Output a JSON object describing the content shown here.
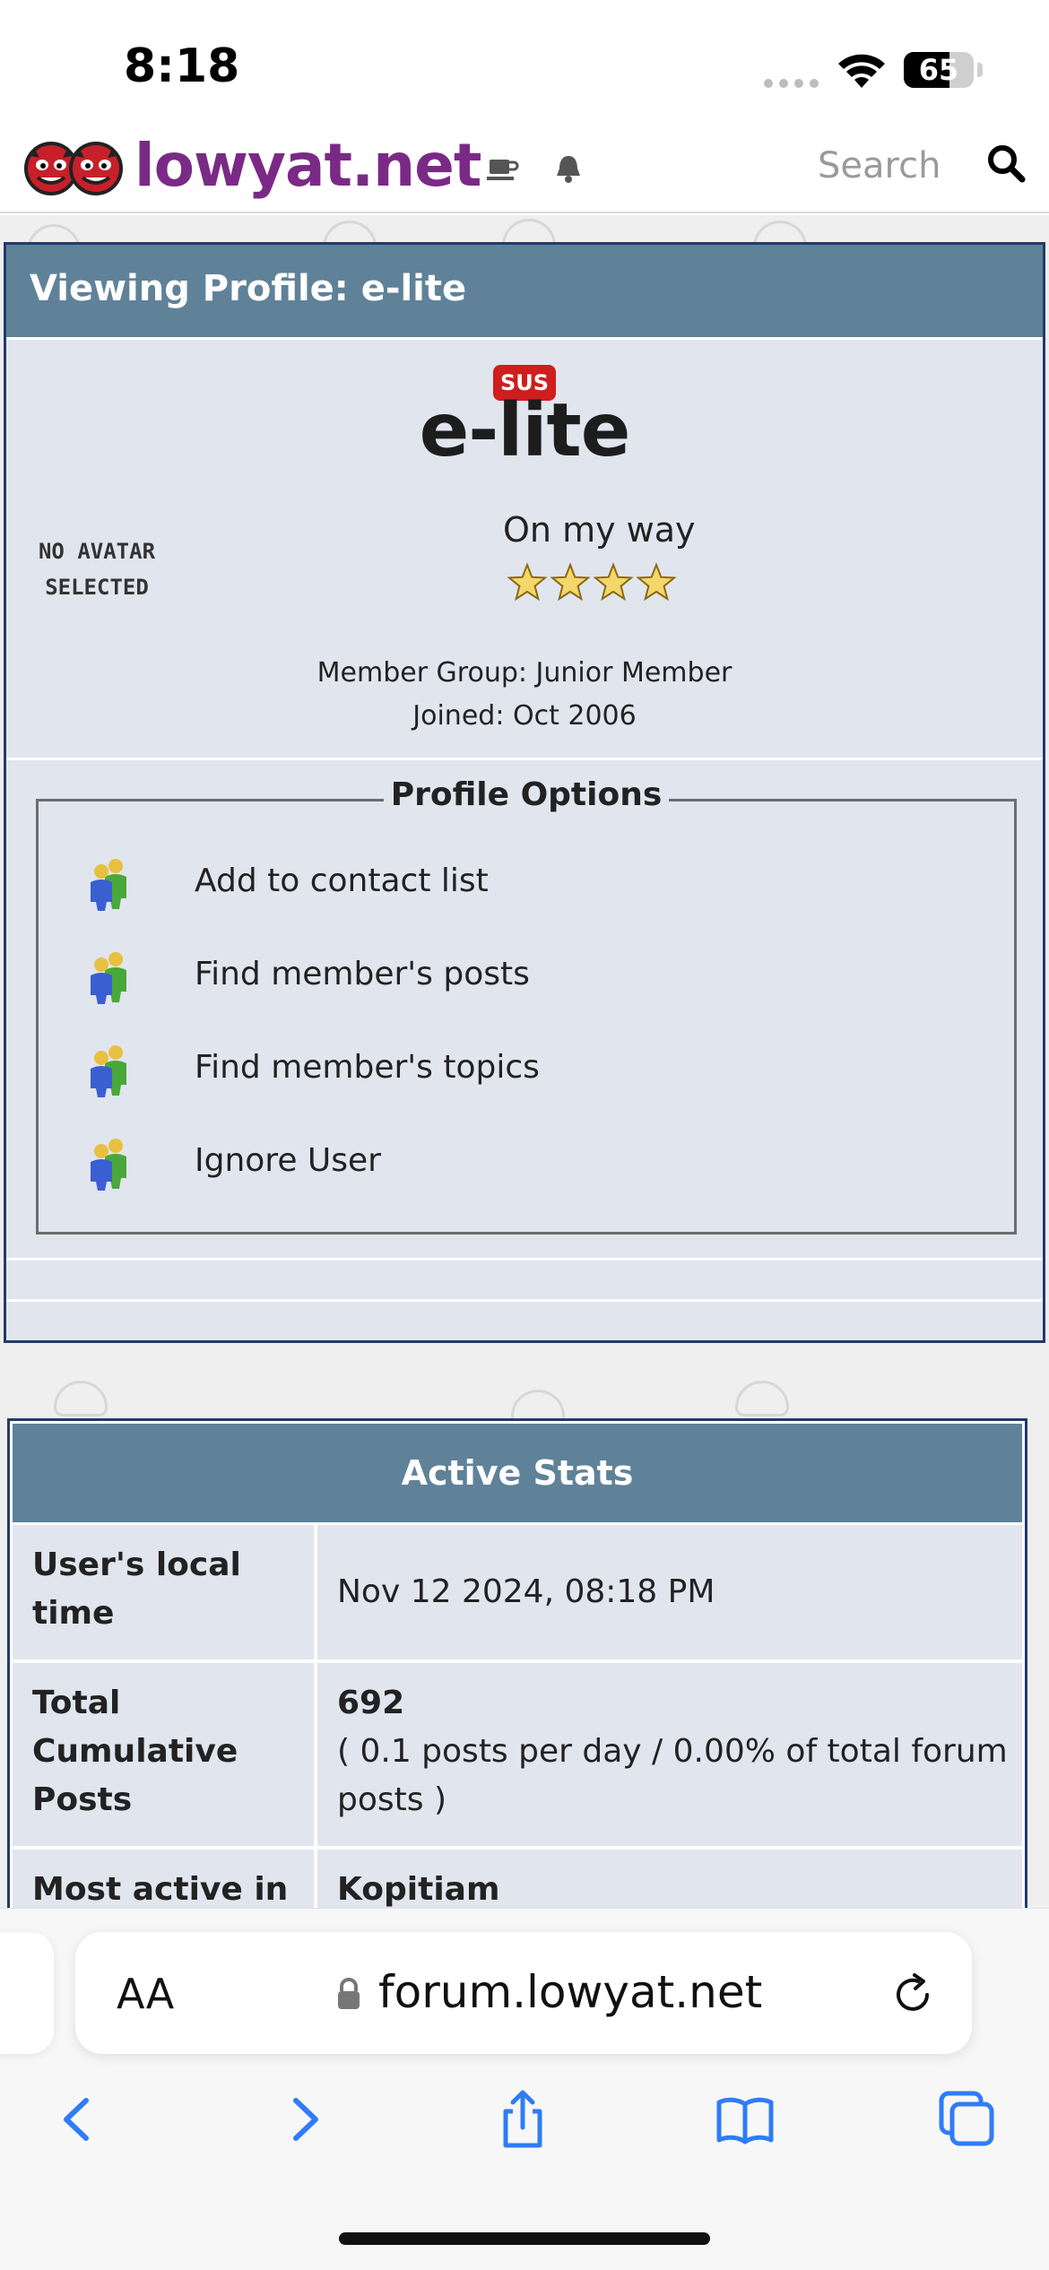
{
  "status_bar": {
    "time": "8:18",
    "battery": "65",
    "battery_level": 0.65
  },
  "header": {
    "logo_text": "lowyat.net",
    "search_placeholder": "Search",
    "brand_color": "#7a2a86",
    "icons": [
      "coffee-icon",
      "bell-icon",
      "search-icon"
    ]
  },
  "profile": {
    "panel_title": "Viewing Profile: e-lite",
    "avatar_placeholder": [
      "NO AVATAR",
      "SELECTED"
    ],
    "status_badge": "SUS",
    "username": "e-lite",
    "user_title": "On my way",
    "star_rating": 4,
    "member_group": "Member Group: Junior Member",
    "joined": "Joined: Oct 2006",
    "header_color": "#5f8299",
    "panel_bg": "#e1e5ee"
  },
  "profile_options": {
    "legend": "Profile Options",
    "items": [
      {
        "label": "Add to contact list",
        "icon": "members-icon"
      },
      {
        "label": "Find member's posts",
        "icon": "members-icon"
      },
      {
        "label": "Find member's topics",
        "icon": "members-icon"
      },
      {
        "label": "Ignore User",
        "icon": "members-icon"
      }
    ]
  },
  "active_stats": {
    "title": "Active Stats",
    "rows": [
      {
        "label": "User's local time",
        "value": "Nov 12 2024, 08:18 PM"
      },
      {
        "label": "Total Cumulative Posts",
        "value": "692",
        "detail": "( 0.1 posts per day / 0.00% of total forum posts )"
      },
      {
        "label": "Most active in",
        "value": "Kopitiam"
      }
    ]
  },
  "browser": {
    "aa_label": "AA",
    "url": "forum.lowyat.net",
    "toolbar": [
      "back-icon",
      "forward-icon",
      "share-icon",
      "bookmarks-icon",
      "tabs-icon"
    ],
    "accent_color": "#2f7cf6"
  }
}
